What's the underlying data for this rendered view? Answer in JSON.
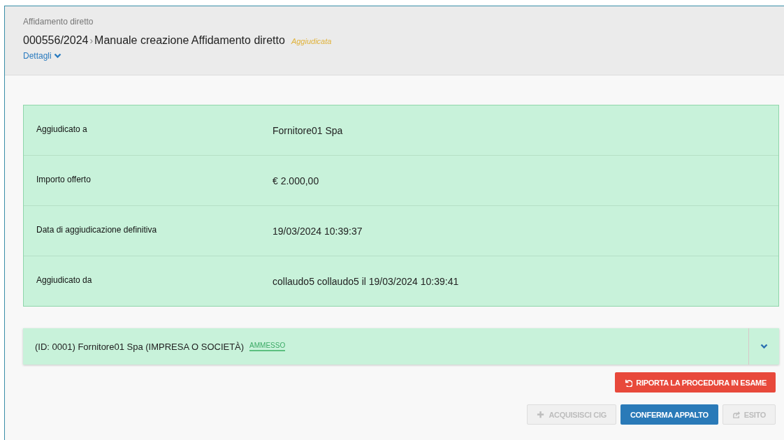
{
  "header": {
    "section": "Affidamento diretto",
    "code": "000556/2024",
    "separator": "›",
    "title": "Manuale creazione Affidamento diretto",
    "status": "Aggiudicata",
    "details_link": "Dettagli",
    "details_expanded": false
  },
  "award": {
    "rows": [
      {
        "label": "Aggiudicato a",
        "value": "Fornitore01 Spa"
      },
      {
        "label": "Importo offerto",
        "value": "€ 2.000,00"
      },
      {
        "label": "Data di aggiudicazione definitiva",
        "value": "19/03/2024 10:39:37"
      },
      {
        "label": "Aggiudicato da",
        "value": "collaudo5 collaudo5 il 19/03/2024 10:39:41"
      }
    ]
  },
  "supplier": {
    "text": "(ID: 0001) Fornitore01 Spa (IMPRESA O SOCIETÀ)",
    "badge": "AMMESSO",
    "expanded": false
  },
  "reset_button": {
    "label": "RIPORTA LA PROCEDURA IN ESAME"
  },
  "actions": [
    {
      "label": "ACQUISISCI CIG",
      "kind": "add",
      "disabled": true
    },
    {
      "label": "CONFERMA APPALTO",
      "kind": "primary",
      "disabled": false
    },
    {
      "label": "ESITO",
      "kind": "share",
      "disabled": true
    }
  ]
}
